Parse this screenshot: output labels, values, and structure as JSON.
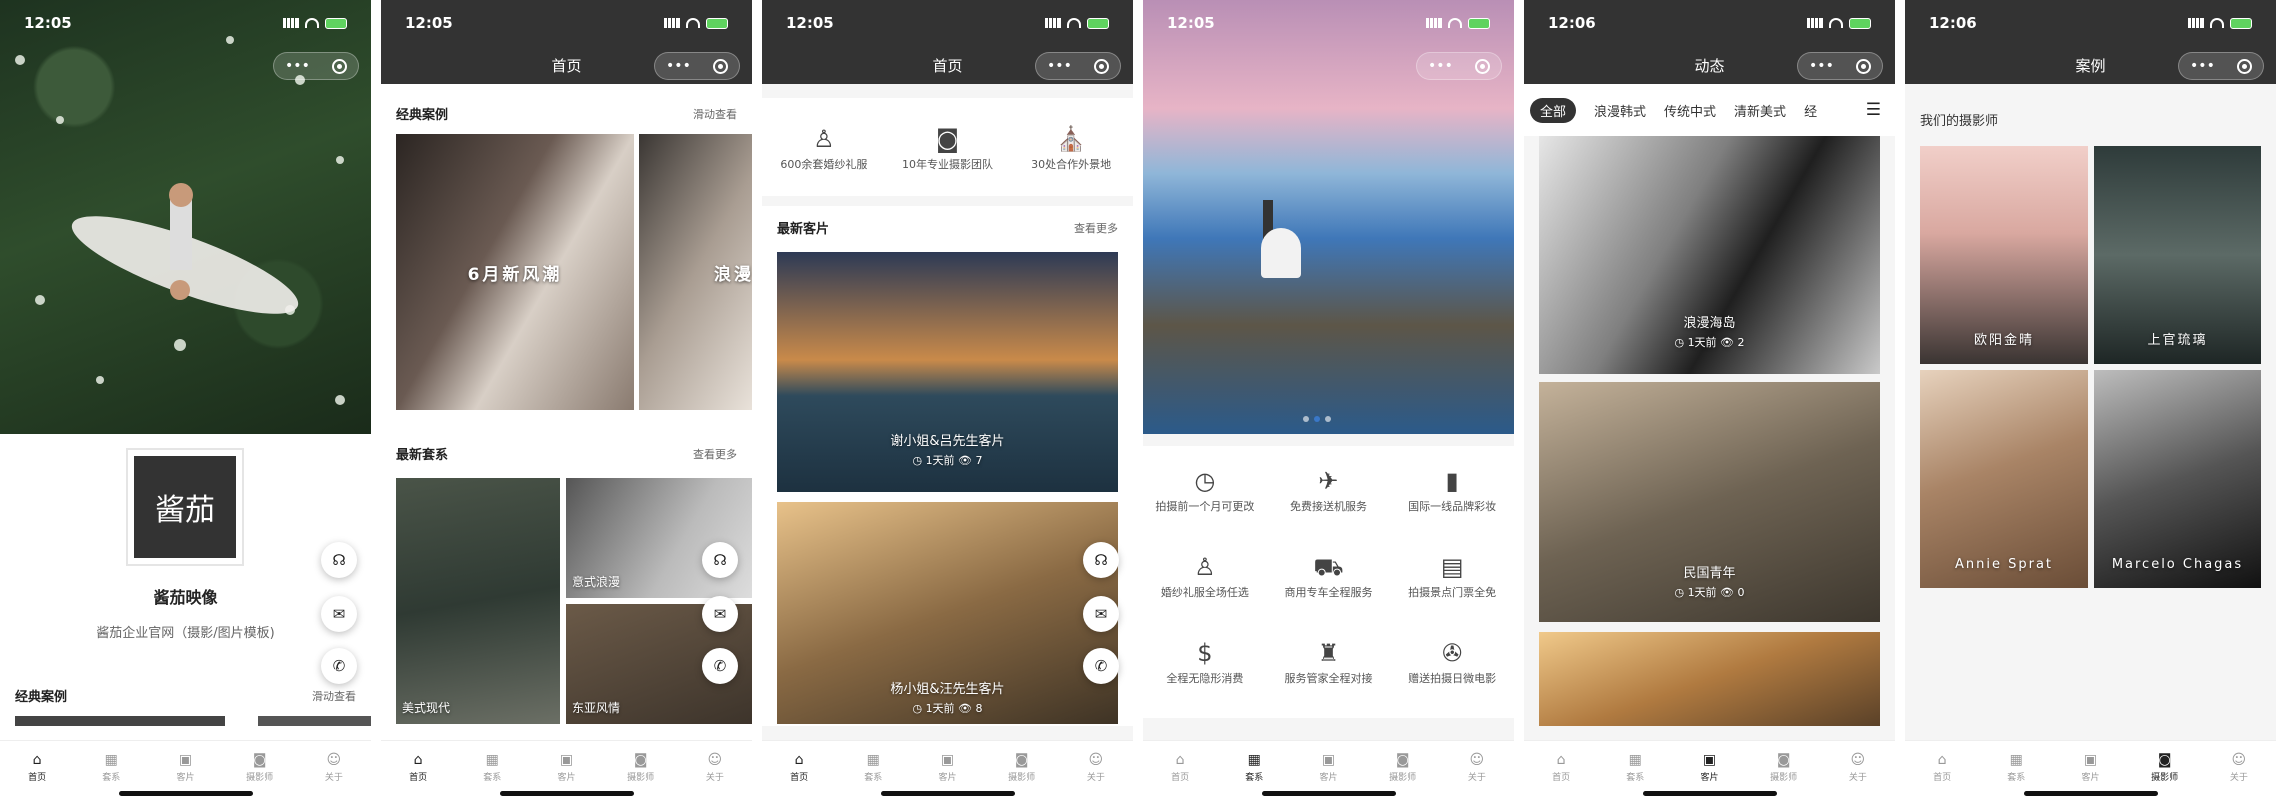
{
  "status": {
    "t1": "12:05",
    "t2": "12:05",
    "t3": "12:05",
    "t4": "12:05",
    "t5": "12:06",
    "t6": "12:06"
  },
  "tabs": [
    "首页",
    "套系",
    "客片",
    "摄影师",
    "关于"
  ],
  "tab_icons": [
    "home-icon",
    "grid-icon",
    "photo-icon",
    "camera-icon",
    "user-icon"
  ],
  "s1": {
    "logo": "酱茄",
    "brand": "酱茄映像",
    "desc": "酱茄企业官网（摄影/图片模板)",
    "section": "经典案例",
    "more": "滑动查看"
  },
  "s2": {
    "title": "首页",
    "classic": "经典案例",
    "classic_more": "滑动查看",
    "card1": "6月新风潮",
    "card2": "浪漫",
    "new": "最新套系",
    "new_more": "查看更多",
    "p1": "美式现代",
    "p2": "意式浪漫",
    "p3": "东亚风情"
  },
  "s3": {
    "title": "首页",
    "f1": "600余套婚纱礼服",
    "f2": "10年专业摄影团队",
    "f3": "30处合作外景地",
    "latest": "最新客片",
    "latest_more": "查看更多",
    "c1": "谢小姐&吕先生客片",
    "c1_time": "1天前",
    "c1_views": "7",
    "c2": "杨小姐&汪先生客片",
    "c2_time": "1天前",
    "c2_views": "8"
  },
  "s4": {
    "items": [
      "拍摄前一个月可更改",
      "免费接送机服务",
      "国际一线品牌彩妆",
      "婚纱礼服全场任选",
      "商用专车全程服务",
      "拍摄景点门票全免",
      "全程无隐形消费",
      "服务管家全程对接",
      "赠送拍摄日微电影"
    ],
    "icons": [
      "clock-icon",
      "plane-icon",
      "lipstick-icon",
      "dress-icon",
      "car-icon",
      "ticket-icon",
      "bill-icon",
      "suit-icon",
      "film-icon"
    ]
  },
  "s5": {
    "title": "动态",
    "chips": [
      "全部",
      "浪漫韩式",
      "传统中式",
      "清新美式",
      "经"
    ],
    "c1": "浪漫海岛",
    "c1_time": "1天前",
    "c1_views": "2",
    "c2": "民国青年",
    "c2_time": "1天前",
    "c2_views": "0"
  },
  "s6": {
    "title": "案例",
    "section": "我们的摄影师",
    "n1": "欧阳金晴",
    "n2": "上官琉璃",
    "n3": "Annie Sprat",
    "n4": "Marcelo Chagas"
  }
}
